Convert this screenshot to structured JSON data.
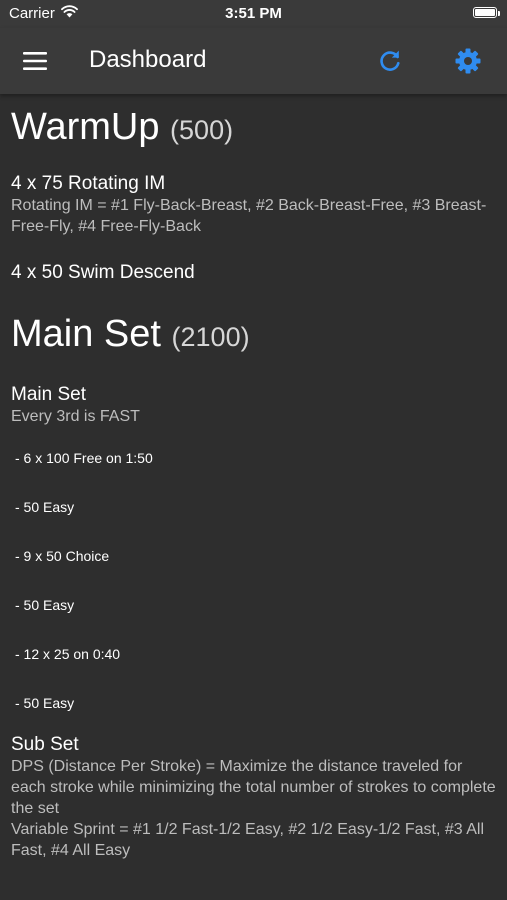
{
  "status_bar": {
    "carrier": "Carrier",
    "time": "3:51 PM"
  },
  "app_bar": {
    "title": "Dashboard",
    "menu_icon": "hamburger-menu-icon",
    "refresh_icon": "refresh-icon",
    "settings_icon": "gear-icon",
    "accent_color": "#2f8cf0"
  },
  "sections": [
    {
      "title": "WarmUp",
      "count": "(500)",
      "sets": [
        {
          "name": "4 x 75 Rotating IM",
          "description": "Rotating IM = #1 Fly-Back-Breast, #2 Back-Breast-Free, #3 Breast-Free-Fly, #4 Free-Fly-Back"
        },
        {
          "name": "4 x 50 Swim Descend"
        }
      ]
    },
    {
      "title": "Main Set",
      "count": "(2100)",
      "main_set": {
        "name": "Main Set",
        "description": "Every 3rd is FAST",
        "items": [
          "- 6 x 100 Free on 1:50",
          "- 50 Easy",
          "- 9 x 50 Choice",
          "- 50 Easy",
          "- 12 x 25 on 0:40",
          "- 50 Easy"
        ]
      },
      "sub_set": {
        "name": "Sub Set",
        "description_1": "DPS (Distance Per Stroke) = Maximize the distance traveled for each stroke while minimizing the total number of strokes to complete the set",
        "description_2": "Variable Sprint = #1 1/2 Fast-1/2 Easy, #2 1/2 Easy-1/2 Fast, #3 All Fast, #4 All Easy"
      }
    }
  ]
}
